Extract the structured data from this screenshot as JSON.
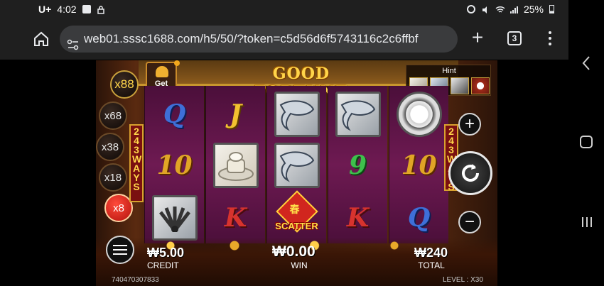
{
  "status_bar": {
    "carrier": "U+",
    "time": "4:02",
    "battery": "25%"
  },
  "browser": {
    "url": "web01.sssc1688.com/h5/50/?token=c5d56d6f5743116c2c6ffbf",
    "tab_count": "3"
  },
  "game": {
    "title": "GOOD FORTUNE",
    "get_more": "Get More",
    "hint_label": "Hint",
    "ways_label": "243 WAYS",
    "multipliers": [
      "x88",
      "x68",
      "x38",
      "x18",
      "x8"
    ],
    "active_multiplier": "x8",
    "reels": [
      [
        "Q",
        "10",
        "fan-card"
      ],
      [
        "J",
        "ingot",
        "K"
      ],
      [
        "fish",
        "fish",
        "SCATTER"
      ],
      [
        "fish",
        "9",
        "K"
      ],
      [
        "coin-medallion",
        "10",
        "Q"
      ]
    ],
    "scatter_label": "SCATTER",
    "scatter_char": "春",
    "credit_value": "₩5.00",
    "credit_label": "CREDIT",
    "win_value": "₩0.00",
    "win_label": "WIN",
    "total_value": "₩240",
    "total_label": "TOTAL",
    "game_id": "740470307833",
    "level_label": "LEVEL : X30"
  },
  "colors": {
    "reel_bg": "#6e1a52",
    "gold": "#ffd54a",
    "active_mult": "#d1261e"
  }
}
